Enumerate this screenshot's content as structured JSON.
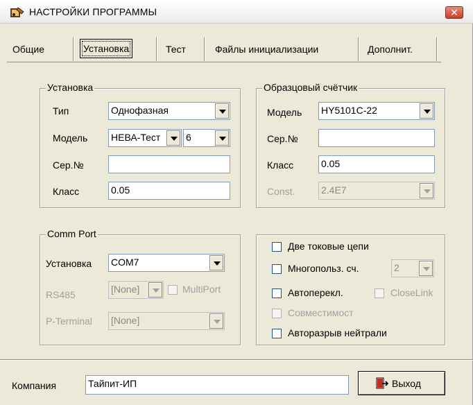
{
  "window": {
    "title": "НАСТРОЙКИ ПРОГРАММЫ",
    "close_symbol": "✕"
  },
  "tabs": [
    {
      "label": "Общие"
    },
    {
      "label": "Установка",
      "selected": true
    },
    {
      "label": "Тест"
    },
    {
      "label": "Файлы инициализации"
    },
    {
      "label": "Дополнит."
    }
  ],
  "installation": {
    "group_title": "Установка",
    "type_label": "Тип",
    "type_value": "Однофазная",
    "model_label": "Модель",
    "model_value": "НЕВА-Тест",
    "model_num_value": "6",
    "serial_label": "Сер.№",
    "serial_value": "",
    "class_label": "Класс",
    "class_value": "0.05"
  },
  "reference_meter": {
    "group_title": "Образцовый счётчик",
    "model_label": "Модель",
    "model_value": "HY5101C-22",
    "serial_label": "Сер.№",
    "serial_value": "",
    "class_label": "Класс",
    "class_value": "0.05",
    "const_label": "Const.",
    "const_value": "2.4E7"
  },
  "comm_port": {
    "group_title": "Comm Port",
    "install_label": "Установка",
    "install_value": "COM7",
    "rs485_label": "RS485",
    "rs485_value": "[None]",
    "multiport_label": "MultiPort",
    "pterminal_label": "P-Terminal",
    "pterminal_value": "[None]"
  },
  "options": {
    "two_current": "Две токовые цепи",
    "multi_user": "Многопольз. сч.",
    "multi_user_value": "2",
    "auto_switch": "Автоперекл.",
    "close_link": "CloseLink",
    "compatibility": "Совместимост",
    "auto_break": "Авторазрыв нейтрали"
  },
  "footer": {
    "company_label": "Компания",
    "company_value": "Тайпит-ИП",
    "exit_label": "Выход"
  },
  "colors": {
    "window_bg": "#ece9d8",
    "close_red": "#c5402c",
    "input_border": "#7f9db9",
    "disabled_text": "#a0a0a0"
  },
  "icons": {
    "title": "settings-app-icon",
    "exit": "exit-door-icon"
  }
}
